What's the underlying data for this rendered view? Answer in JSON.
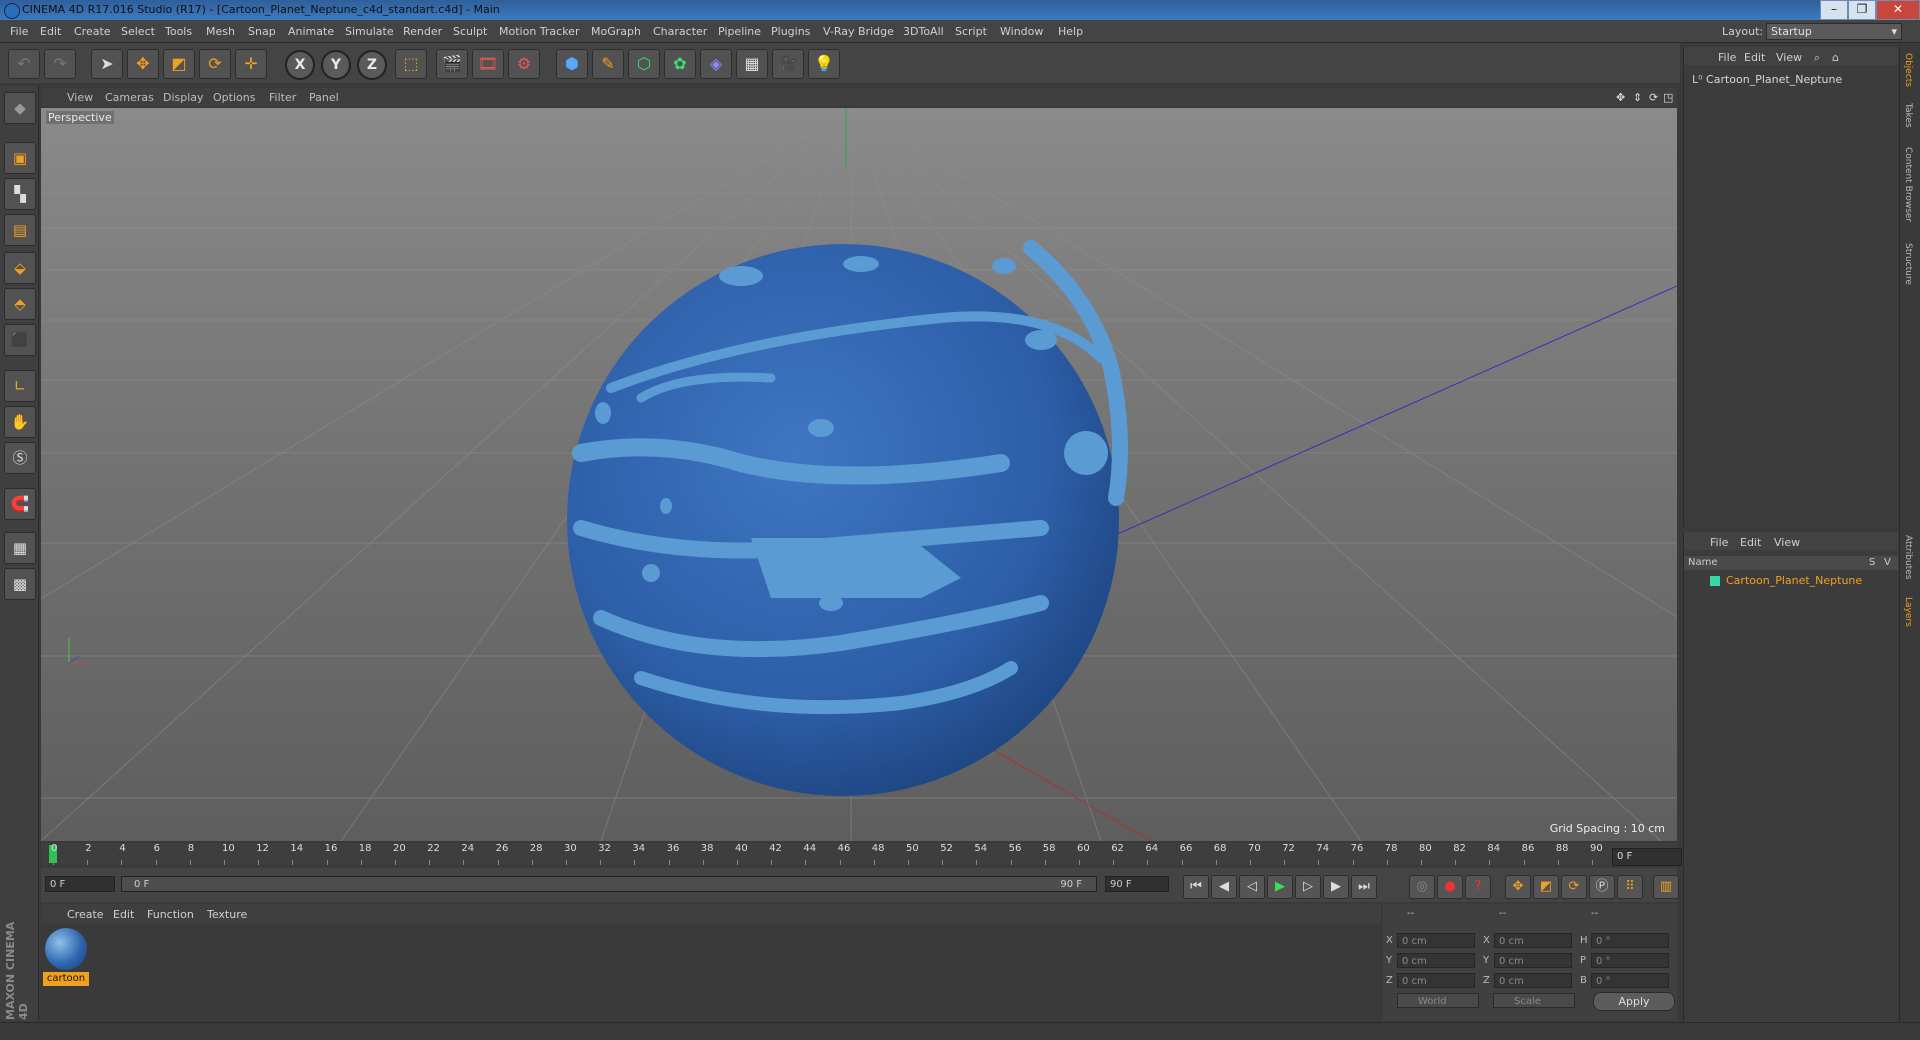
{
  "window": {
    "title": "CINEMA 4D R17.016 Studio (R17) - [Cartoon_Planet_Neptune_c4d_standart.c4d] - Main",
    "min": "–",
    "max": "❐",
    "close": "✕"
  },
  "menubar": {
    "items": [
      "File",
      "Edit",
      "Create",
      "Select",
      "Tools",
      "Mesh",
      "Snap",
      "Animate",
      "Simulate",
      "Render",
      "Sculpt",
      "Motion Tracker",
      "MoGraph",
      "Character",
      "Pipeline",
      "Plugins",
      "V-Ray Bridge",
      "3DToAll",
      "Script",
      "Window",
      "Help"
    ],
    "layout_label": "Layout:",
    "layout_value": "Startup"
  },
  "viewport": {
    "menu": [
      "View",
      "Cameras",
      "Display",
      "Options",
      "Filter",
      "Panel"
    ],
    "label": "Perspective",
    "grid_spacing": "Grid Spacing : 10 cm"
  },
  "timeline": {
    "ticks": [
      "0",
      "2",
      "4",
      "6",
      "8",
      "10",
      "12",
      "14",
      "16",
      "18",
      "20",
      "22",
      "24",
      "26",
      "28",
      "30",
      "32",
      "34",
      "36",
      "38",
      "40",
      "42",
      "44",
      "46",
      "48",
      "50",
      "52",
      "54",
      "56",
      "58",
      "60",
      "62",
      "64",
      "66",
      "68",
      "70",
      "72",
      "74",
      "76",
      "78",
      "80",
      "82",
      "84",
      "86",
      "88",
      "90"
    ],
    "current_frame": "0 F",
    "start_frame": "0 F",
    "range_start": "0 F",
    "range_end": "90 F",
    "end_frame": "90 F"
  },
  "material_manager": {
    "menu": [
      "Create",
      "Edit",
      "Function",
      "Texture"
    ],
    "material_name": "cartoon"
  },
  "coordinates": {
    "header": [
      "--",
      "--",
      "--"
    ],
    "rows": [
      {
        "a": "X",
        "av": "0 cm",
        "b": "X",
        "bv": "0 cm",
        "c": "H",
        "cv": "0 °"
      },
      {
        "a": "Y",
        "av": "0 cm",
        "b": "Y",
        "bv": "0 cm",
        "c": "P",
        "cv": "0 °"
      },
      {
        "a": "Z",
        "av": "0 cm",
        "b": "Z",
        "bv": "0 cm",
        "c": "B",
        "cv": "0 °"
      }
    ],
    "mode1": "World",
    "mode2": "Scale",
    "apply": "Apply"
  },
  "object_manager": {
    "menu": [
      "File",
      "Edit",
      "View"
    ],
    "object": "Cartoon_Planet_Neptune"
  },
  "layer_manager": {
    "menu": [
      "File",
      "Edit",
      "View"
    ],
    "col_name": "Name",
    "col_s": "S",
    "col_v": "V",
    "layer": "Cartoon_Planet_Neptune"
  },
  "side_tabs": [
    "Objects",
    "Takes",
    "Content Browser",
    "Structure",
    "Attributes",
    "Layers"
  ],
  "branding": "MAXON CINEMA 4D",
  "colors": {
    "accent": "#f0a020",
    "planet_dark": "#2f5fa8",
    "planet_light": "#5b9bd4"
  }
}
